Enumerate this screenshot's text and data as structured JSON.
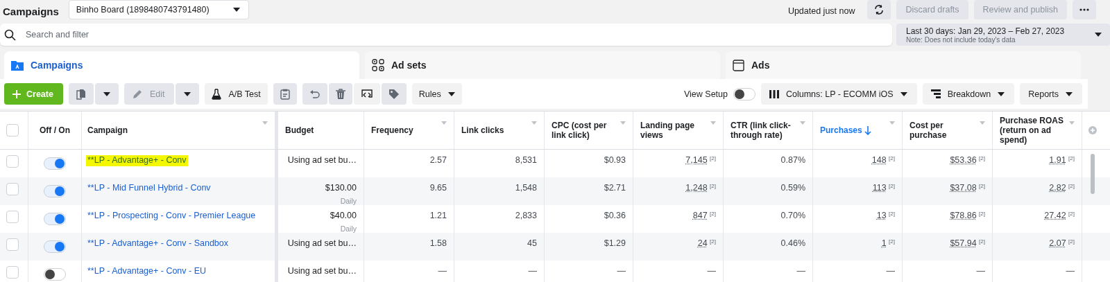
{
  "top_bar": {
    "title": "Campaigns",
    "account": "Binho Board (1898480743791480)",
    "updated": "Updated just now",
    "buttons": [
      {
        "label": "Discard drafts",
        "disabled": true
      },
      {
        "label": "Review and publish",
        "disabled": true
      }
    ]
  },
  "search": {
    "placeholder": "Search and filter"
  },
  "date_range": {
    "label": "Last 30 days: Jan 29, 2023 – Feb 27, 2023",
    "note": "Note: Does not include today's data"
  },
  "tabs": [
    {
      "label": "Campaigns",
      "kind": "campaigns",
      "selected": true
    },
    {
      "label": "Ad sets",
      "kind": "adsets",
      "selected": false
    },
    {
      "label": "Ads",
      "kind": "ads",
      "selected": false
    }
  ],
  "toolbar": {
    "create": "Create",
    "edit": {
      "label": "Edit",
      "disabled": true
    },
    "ab_test": "A/B Test",
    "rules": "Rules",
    "view_setup": {
      "label": "View Setup",
      "on": false
    },
    "columns": "Columns: LP - ECOMM iOS",
    "breakdown": "Breakdown",
    "reports": "Reports"
  },
  "table": {
    "select_all": {
      "checked": false
    },
    "columns": [
      {
        "label": "Off / On",
        "sortable": false,
        "sorted": false
      },
      {
        "label": "Campaign",
        "sortable": true,
        "sorted": false
      },
      {
        "label": "Budget",
        "sortable": false,
        "sorted": false
      },
      {
        "label": "Frequency",
        "sortable": true,
        "sorted": false
      },
      {
        "label": "Link clicks",
        "sortable": true,
        "sorted": false
      },
      {
        "label": "CPC (cost per link click)",
        "sortable": true,
        "sorted": false
      },
      {
        "label": "Landing page views",
        "sortable": true,
        "sorted": false
      },
      {
        "label": "CTR (link click-through rate)",
        "sortable": true,
        "sorted": false
      },
      {
        "label": "Purchases",
        "sortable": true,
        "sorted": true
      },
      {
        "label": "Cost per purchase",
        "sortable": true,
        "sorted": false
      },
      {
        "label": "Purchase ROAS (return on ad spend)",
        "sortable": true,
        "sorted": false
      }
    ],
    "rows": [
      {
        "checked": false,
        "on": true,
        "highlighted": true,
        "campaign": "**LP - Advantage+ - Conv",
        "budget": "Using ad set bu…",
        "metrics": [
          {
            "text": "2.57"
          },
          {
            "text": "8,531"
          },
          {
            "text": "$0.93"
          },
          {
            "text": "7,145",
            "note": "[2]"
          },
          {
            "text": "0.87%"
          },
          {
            "text": "148",
            "note": "[2]"
          },
          {
            "text": "$53.36",
            "note": "[2]"
          },
          {
            "text": "1.91",
            "note": "[2]"
          }
        ]
      },
      {
        "checked": false,
        "on": true,
        "highlighted": false,
        "campaign": "**LP - Mid Funnel Hybrid - Conv",
        "budget": "$130.00",
        "budget_period": "Daily",
        "metrics": [
          {
            "text": "9.65"
          },
          {
            "text": "1,548"
          },
          {
            "text": "$2.71"
          },
          {
            "text": "1,248",
            "note": "[2]"
          },
          {
            "text": "0.59%"
          },
          {
            "text": "113",
            "note": "[2]"
          },
          {
            "text": "$37.08",
            "note": "[2]"
          },
          {
            "text": "2.82",
            "note": "[2]"
          }
        ]
      },
      {
        "checked": false,
        "on": true,
        "highlighted": false,
        "campaign": "**LP - Prospecting - Conv - Premier League",
        "budget": "$40.00",
        "budget_period": "Daily",
        "metrics": [
          {
            "text": "1.21"
          },
          {
            "text": "2,833"
          },
          {
            "text": "$0.36"
          },
          {
            "text": "847",
            "note": "[2]"
          },
          {
            "text": "0.70%"
          },
          {
            "text": "13",
            "note": "[2]"
          },
          {
            "text": "$78.86",
            "note": "[2]"
          },
          {
            "text": "27.42",
            "note": "[2]"
          }
        ]
      },
      {
        "checked": false,
        "on": true,
        "highlighted": false,
        "campaign": "**LP - Advantage+ - Conv - Sandbox",
        "budget": "Using ad set bu…",
        "metrics": [
          {
            "text": "1.58"
          },
          {
            "text": "45"
          },
          {
            "text": "$1.29"
          },
          {
            "text": "24",
            "note": "[2]"
          },
          {
            "text": "0.46%"
          },
          {
            "text": "1",
            "note": "[2]"
          },
          {
            "text": "$57.94",
            "note": "[2]"
          },
          {
            "text": "2.07",
            "note": "[2]"
          }
        ]
      },
      {
        "checked": false,
        "on": false,
        "highlighted": false,
        "campaign": "**LP - Advantage+ - Conv - EU",
        "budget": "Using ad set bu…",
        "metrics": [
          {
            "text": "—"
          },
          {
            "text": "—"
          },
          {
            "text": "—"
          },
          {
            "text": "—"
          },
          {
            "text": "—"
          },
          {
            "text": "—"
          },
          {
            "text": "—"
          },
          {
            "text": "—"
          }
        ]
      }
    ]
  }
}
